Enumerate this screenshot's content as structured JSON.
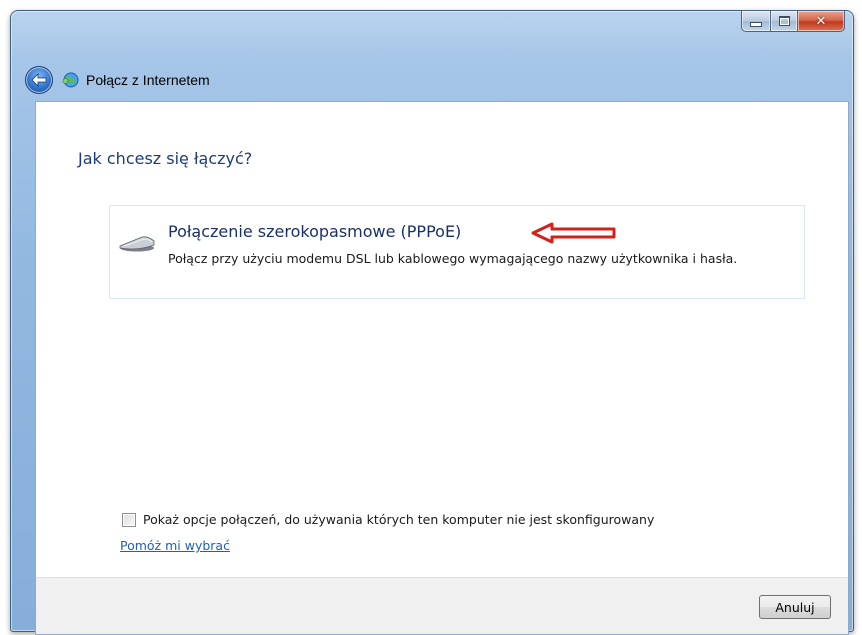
{
  "window": {
    "title": "Połącz z Internetem",
    "controls": {
      "minimize": "minimize",
      "maximize": "maximize",
      "close": "✕"
    }
  },
  "main": {
    "heading": "Jak chcesz się łączyć?",
    "option": {
      "title": "Połączenie szerokopasmowe (PPPoE)",
      "description": "Połącz przy użyciu modemu DSL lub kablowego wymagającego nazwy użytkownika i hasła.",
      "icon": "modem-icon",
      "annotation_color": "#d0211c"
    },
    "show_options_checkbox": {
      "label": "Pokaż opcje połączeń, do używania których ten komputer nie jest skonfigurowany",
      "checked": false
    },
    "help_link": "Pomóż mi wybrać"
  },
  "footer": {
    "cancel_label": "Anuluj"
  },
  "colors": {
    "heading": "#1f3c7a",
    "link": "#1f5fb5",
    "close_button": "#c2381c"
  }
}
